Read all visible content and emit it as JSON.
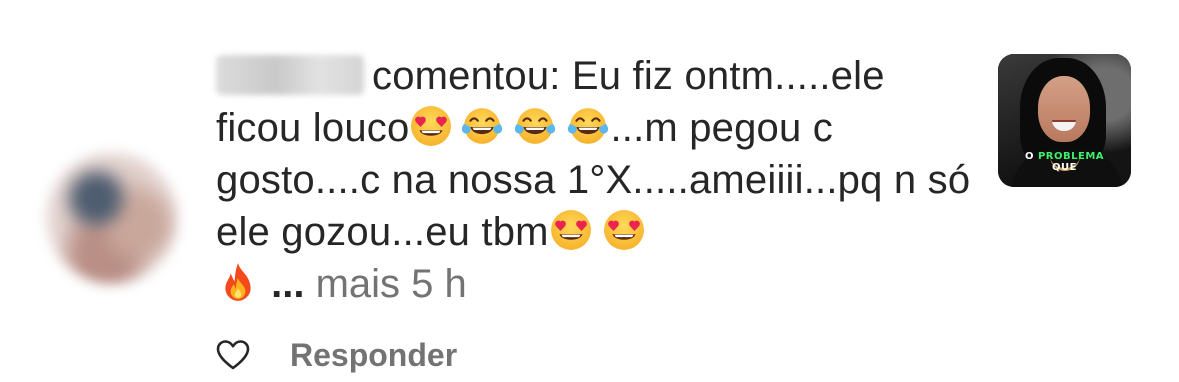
{
  "comment": {
    "text_part1": "comentou: Eu fiz ontm.....ele ficou louco",
    "text_part2": "...m pegou c gosto....c na nossa 1°X.....ameiiii...pq n só ele gozou...eu tbm",
    "ellipsis": "...",
    "more_label": "mais",
    "time": "5 h"
  },
  "actions": {
    "reply_label": "Responder"
  },
  "thumbnail": {
    "caption_line1_a": "O ",
    "caption_line1_b": "PROBLEMA",
    "caption_line2": "QUE"
  },
  "icons": {
    "heart_eyes": "heart-eyes-emoji",
    "tears_of_joy": "tears-of-joy-emoji",
    "fire": "fire-emoji",
    "like": "heart-outline-icon"
  },
  "colors": {
    "text": "#262626",
    "secondary": "#737373",
    "caption_accent": "#3df06a"
  }
}
